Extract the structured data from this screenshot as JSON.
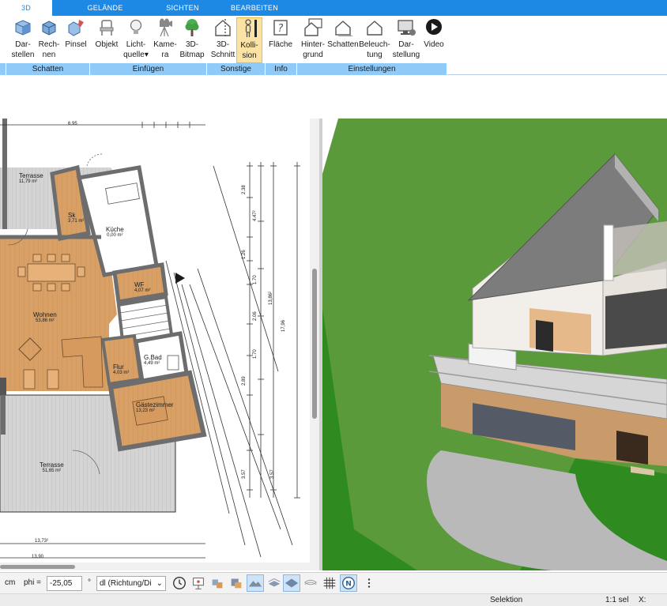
{
  "ribbon": {
    "tabs": [
      {
        "label": "3D",
        "active": true
      },
      {
        "label": "GELÄNDE",
        "active": false
      },
      {
        "label": "SICHTEN",
        "active": false
      },
      {
        "label": "BEARBEITEN",
        "active": false
      }
    ],
    "buttons": {
      "darstellen": {
        "line1": "Dar-",
        "line2": "stellen"
      },
      "rechnen": {
        "line1": "Rech-",
        "line2": "nen"
      },
      "pinsel": {
        "line1": "Pinsel",
        "line2": ""
      },
      "objekt": {
        "line1": "Objekt",
        "line2": ""
      },
      "lichtquelle": {
        "line1": "Licht-",
        "line2": "quelle"
      },
      "kamera": {
        "line1": "Kame-",
        "line2": "ra"
      },
      "bitmap3d": {
        "line1": "3D-",
        "line2": "Bitmap"
      },
      "schnitt3d": {
        "line1": "3D-",
        "line2": "Schnitt"
      },
      "kollision": {
        "line1": "Kolli-",
        "line2": "sion"
      },
      "flaeche": {
        "line1": "Fläche",
        "line2": ""
      },
      "hintergrund": {
        "line1": "Hinter-",
        "line2": "grund"
      },
      "schatten": {
        "line1": "Schatten",
        "line2": ""
      },
      "beleuchtung": {
        "line1": "Beleuch-",
        "line2": "tung"
      },
      "darstellung": {
        "line1": "Dar-",
        "line2": "stellung"
      },
      "video": {
        "line1": "Video",
        "line2": ""
      }
    },
    "groups": {
      "schatten": "Schatten",
      "einfuegen": "Einfügen",
      "sonstige": "Sonstige",
      "info": "Info",
      "einstellungen": "Einstellungen"
    },
    "colors": {
      "tab_bar": "#1e88e5",
      "group_bar": "#90caf9",
      "active_button": "#fbe3a6"
    }
  },
  "plan": {
    "rooms": {
      "terrasse_top": {
        "name": "Terrasse",
        "area": "11,79 m²"
      },
      "sk": {
        "name": "Sk",
        "area": "3,71 m²"
      },
      "kueche": {
        "name": "Küche",
        "area": "0,00 m²"
      },
      "wohnen": {
        "name": "Wohnen",
        "area": "53,86 m²"
      },
      "wf": {
        "name": "WF",
        "area": "4,07 m²"
      },
      "gbad": {
        "name": "G.Bad",
        "area": "4,49 m²"
      },
      "flur": {
        "name": "Flur",
        "area": "4,03 m²"
      },
      "gaestezimmer": {
        "name": "Gästezimmer",
        "area": "13,23 m²"
      },
      "terrasse_bottom": {
        "name": "Terrasse",
        "area": "51,65 m²"
      }
    },
    "dimensions": {
      "top": "6.95",
      "bottom_1": "13,73²",
      "bottom_2": "13,90",
      "right_total": "17,96",
      "right_sub": "13,86²",
      "chain": [
        "2.38",
        "4.47²",
        "1.26",
        "1.70",
        "2.06",
        "1.70",
        "2.89",
        "3.57",
        "3.57"
      ]
    }
  },
  "bottombar": {
    "unit": "cm",
    "phi_label": "phi =",
    "phi_value": "-25,05",
    "degree": "°",
    "dl_value": "dl (Richtung/Di",
    "north": "N"
  },
  "status": {
    "mode": "Selektion",
    "scale": "1:1 sel",
    "x_label": "X:"
  }
}
